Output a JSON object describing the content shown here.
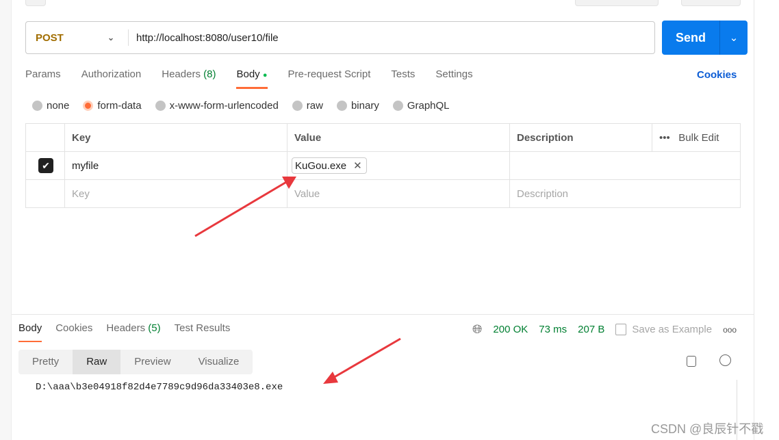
{
  "request": {
    "method": "POST",
    "url": "http://localhost:8080/user10/file",
    "send_label": "Send"
  },
  "tabs": [
    {
      "label": "Params"
    },
    {
      "label": "Authorization"
    },
    {
      "label": "Headers",
      "count": "(8)"
    },
    {
      "label": "Body",
      "active": true
    },
    {
      "label": "Pre-request Script"
    },
    {
      "label": "Tests"
    },
    {
      "label": "Settings"
    }
  ],
  "cookies_label": "Cookies",
  "body_types": [
    {
      "label": "none"
    },
    {
      "label": "form-data",
      "selected": true
    },
    {
      "label": "x-www-form-urlencoded"
    },
    {
      "label": "raw"
    },
    {
      "label": "binary"
    },
    {
      "label": "GraphQL"
    }
  ],
  "form_table": {
    "headers": {
      "key": "Key",
      "value": "Value",
      "description": "Description",
      "bulk_edit": "Bulk Edit"
    },
    "rows": [
      {
        "checked": true,
        "key": "myfile",
        "value": "KuGou.exe"
      }
    ],
    "placeholders": {
      "key": "Key",
      "value": "Value",
      "description": "Description"
    }
  },
  "response": {
    "tabs": [
      {
        "label": "Body",
        "active": true
      },
      {
        "label": "Cookies"
      },
      {
        "label": "Headers",
        "count": "(5)"
      },
      {
        "label": "Test Results"
      }
    ],
    "status": "200 OK",
    "time": "73 ms",
    "size": "207 B",
    "save_example": "Save as Example",
    "formats": [
      {
        "label": "Pretty"
      },
      {
        "label": "Raw",
        "active": true
      },
      {
        "label": "Preview"
      },
      {
        "label": "Visualize"
      }
    ],
    "body_text": "D:\\aaa\\b3e04918f82d4e7789c9d96da33403e8.exe"
  },
  "watermark": "CSDN @良辰针不戳",
  "colors": {
    "accent": "#ff6c37",
    "send": "#097bed",
    "status_green": "#007f31",
    "annotation_arrow": "#e8383d"
  }
}
